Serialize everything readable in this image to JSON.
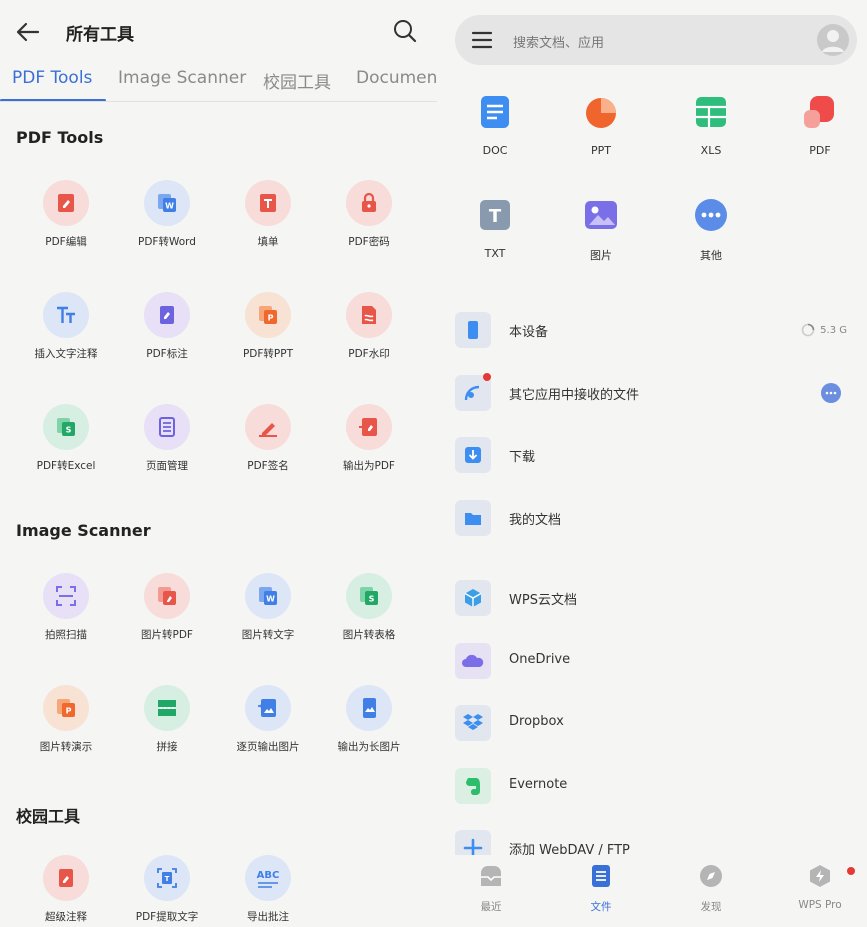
{
  "left": {
    "title": "所有工具",
    "tabs": [
      "PDF Tools",
      "Image Scanner",
      "校园工具",
      "Document"
    ],
    "active_tab": "PDF Tools",
    "sections": [
      {
        "title": "PDF Tools",
        "tools": [
          {
            "label": "PDF编辑",
            "icon": "pdf-edit-icon"
          },
          {
            "label": "PDF转Word",
            "icon": "pdf-to-word-icon"
          },
          {
            "label": "填单",
            "icon": "fill-form-icon"
          },
          {
            "label": "PDF密码",
            "icon": "pdf-lock-icon"
          },
          {
            "label": "插入文字注释",
            "icon": "text-annotation-icon"
          },
          {
            "label": "PDF标注",
            "icon": "pdf-markup-icon"
          },
          {
            "label": "PDF转PPT",
            "icon": "pdf-to-ppt-icon"
          },
          {
            "label": "PDF水印",
            "icon": "pdf-watermark-icon"
          },
          {
            "label": "PDF转Excel",
            "icon": "pdf-to-excel-icon"
          },
          {
            "label": "页面管理",
            "icon": "page-manage-icon"
          },
          {
            "label": "PDF签名",
            "icon": "pdf-sign-icon"
          },
          {
            "label": "输出为PDF",
            "icon": "export-pdf-icon"
          }
        ]
      },
      {
        "title": "Image Scanner",
        "tools": [
          {
            "label": "拍照扫描",
            "icon": "photo-scan-icon"
          },
          {
            "label": "图片转PDF",
            "icon": "image-to-pdf-icon"
          },
          {
            "label": "图片转文字",
            "icon": "image-to-text-icon"
          },
          {
            "label": "图片转表格",
            "icon": "image-to-sheet-icon"
          },
          {
            "label": "图片转演示",
            "icon": "image-to-slides-icon"
          },
          {
            "label": "拼接",
            "icon": "stitch-icon"
          },
          {
            "label": "逐页输出图片",
            "icon": "export-pages-image-icon"
          },
          {
            "label": "输出为长图片",
            "icon": "export-long-image-icon"
          }
        ]
      },
      {
        "title": "校园工具",
        "tools": [
          {
            "label": "超级注释",
            "icon": "super-annotation-icon"
          },
          {
            "label": "PDF提取文字",
            "icon": "pdf-extract-text-icon"
          },
          {
            "label": "导出批注",
            "icon": "export-comments-icon"
          }
        ]
      }
    ]
  },
  "right": {
    "search_placeholder": "搜索文档、应用",
    "file_types": [
      {
        "label": "DOC",
        "icon": "doc-icon",
        "color": "#3d8ef0"
      },
      {
        "label": "PPT",
        "icon": "ppt-icon",
        "color": "#f0642e"
      },
      {
        "label": "XLS",
        "icon": "xls-icon",
        "color": "#2ebd7a"
      },
      {
        "label": "PDF",
        "icon": "pdf-icon",
        "color": "#ef4b4b"
      },
      {
        "label": "TXT",
        "icon": "txt-icon",
        "color": "#8a9aae"
      },
      {
        "label": "图片",
        "icon": "image-icon",
        "color": "#7b6fe8"
      },
      {
        "label": "其他",
        "icon": "more-icon",
        "color": "#5b8de8"
      }
    ],
    "locations": [
      {
        "label": "本设备",
        "icon": "phone-icon",
        "extra": "5.3 G"
      },
      {
        "label": "其它应用中接收的文件",
        "icon": "received-files-icon",
        "extra": ""
      },
      {
        "label": "下载",
        "icon": "download-icon",
        "extra": ""
      },
      {
        "label": "我的文档",
        "icon": "folder-icon",
        "extra": ""
      }
    ],
    "clouds": [
      {
        "label": "WPS云文档",
        "icon": "wps-cloud-icon"
      },
      {
        "label": "OneDrive",
        "icon": "onedrive-icon"
      },
      {
        "label": "Dropbox",
        "icon": "dropbox-icon"
      },
      {
        "label": "Evernote",
        "icon": "evernote-icon"
      },
      {
        "label": "添加 WebDAV / FTP",
        "icon": "add-icon"
      }
    ],
    "nav": [
      {
        "label": "最近",
        "icon": "recent-icon"
      },
      {
        "label": "文件",
        "icon": "file-icon"
      },
      {
        "label": "发现",
        "icon": "discover-icon"
      },
      {
        "label": "WPS Pro",
        "icon": "wps-pro-icon"
      }
    ],
    "active_nav": "文件",
    "accent": "#3b6fd8"
  }
}
